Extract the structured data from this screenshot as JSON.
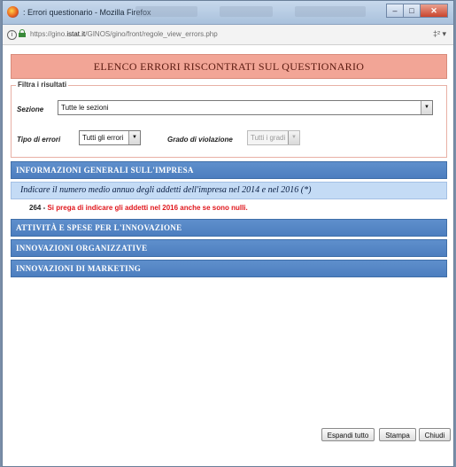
{
  "window": {
    "title": ": Errori questionario - Mozilla Firefox",
    "url_prefix": "https://gino.",
    "url_domain": "istat.it",
    "url_path": "/GINOS/gino/front/regole_view_errors.php",
    "url_right": "‡² ▾"
  },
  "page": {
    "title": "ELENCO ERRORI RISCONTRATI SUL QUESTIONARIO"
  },
  "filter": {
    "legend": "Filtra i risultati",
    "sezione_label": "Sezione",
    "sezione_value": "Tutte le sezioni",
    "tipo_label": "Tipo di errori",
    "tipo_value": "Tutti gli errori",
    "grado_label": "Grado di violazione",
    "grado_value": "Tutti i gradi"
  },
  "sections": [
    "INFORMAZIONI GENERALI SULL'IMPRESA",
    "ATTIVITÀ E SPESE PER L'INNOVAZIONE",
    "INNOVAZIONI ORGANIZZATIVE",
    "INNOVAZIONI DI MARKETING"
  ],
  "subsection": "Indicare il numero medio annuo degli addetti dell'impresa nel 2014 e nel 2016 (*)",
  "error": {
    "code": "264 -",
    "message": "Si prega di indicare gli addetti nel 2016 anche se sono nulli."
  },
  "buttons": {
    "expand": "Espandi tutto",
    "print": "Stampa",
    "close": "Chiudi"
  },
  "colors": {
    "title_bg": "#f2a596",
    "section_bg": "#4c7ebf",
    "subsection_bg": "#c4dbf5",
    "error_text": "#e0151b"
  }
}
